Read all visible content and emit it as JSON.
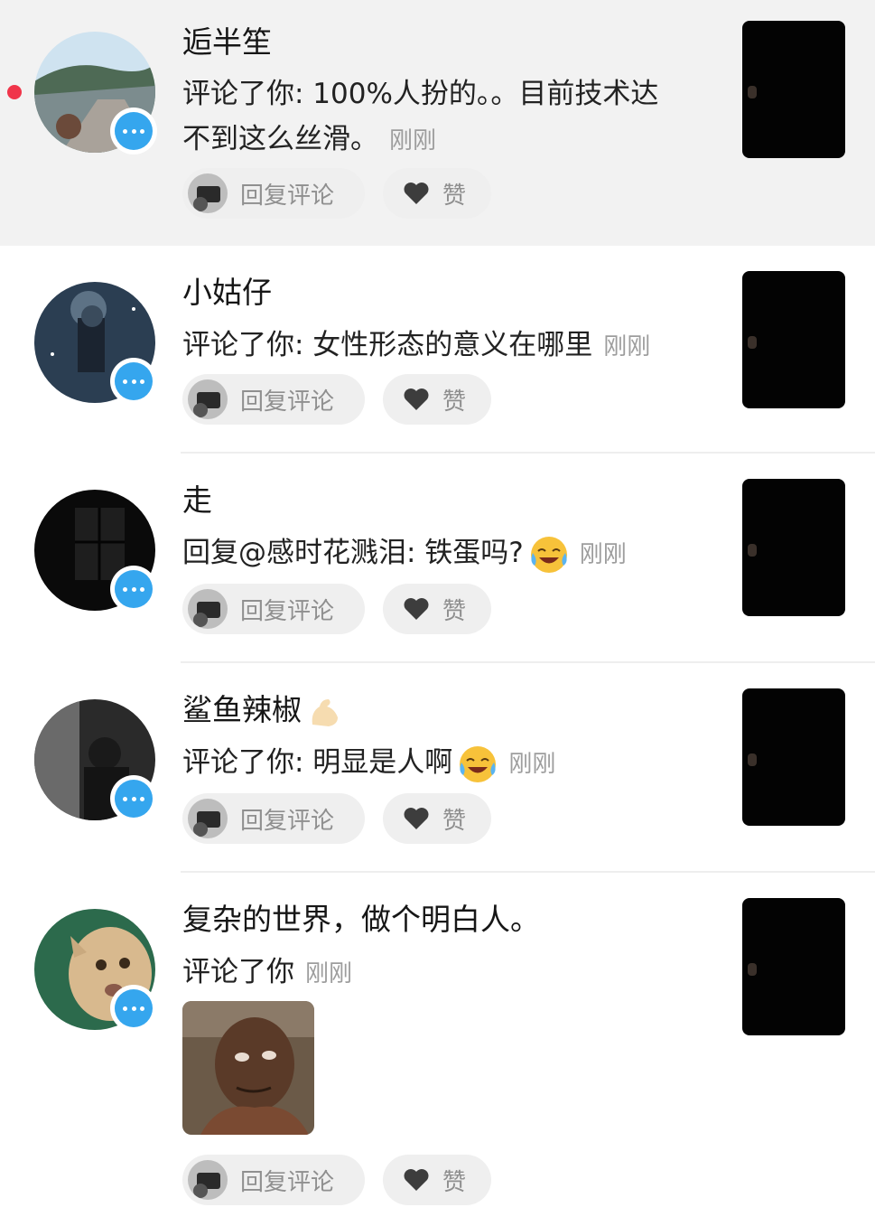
{
  "notifications": [
    {
      "name": "逅半笙",
      "line1": "评论了你: 100%人扮的。。目前技术达",
      "line2": "不到这么丝滑。",
      "time": "刚刚",
      "unread": true
    },
    {
      "name": "小姑仔",
      "line1": "评论了你: 女性形态的意义在哪里",
      "time": "刚刚"
    },
    {
      "name": "走",
      "line1": "回复@感时花溅泪: 铁蛋吗?",
      "emoji": "crying-laughing-emoji",
      "time": "刚刚"
    },
    {
      "name": "鲨鱼辣椒",
      "name_emoji": "flexed-biceps-emoji",
      "line1": "评论了你: 明显是人啊",
      "emoji": "crying-laughing-emoji",
      "time": "刚刚"
    },
    {
      "name": "复杂的世界，做个明白人。",
      "line1": "评论了你",
      "time": "刚刚",
      "attachment": "meme-sticker-image"
    }
  ],
  "actions": {
    "reply_label": "回复评论",
    "like_label": "赞"
  },
  "colors": {
    "unread_bg": "#f2f2f2",
    "unread_dot": "#f0354a",
    "badge": "#35a6ee",
    "secondary_text": "#9d9d9d",
    "button_bg": "#efefef"
  }
}
